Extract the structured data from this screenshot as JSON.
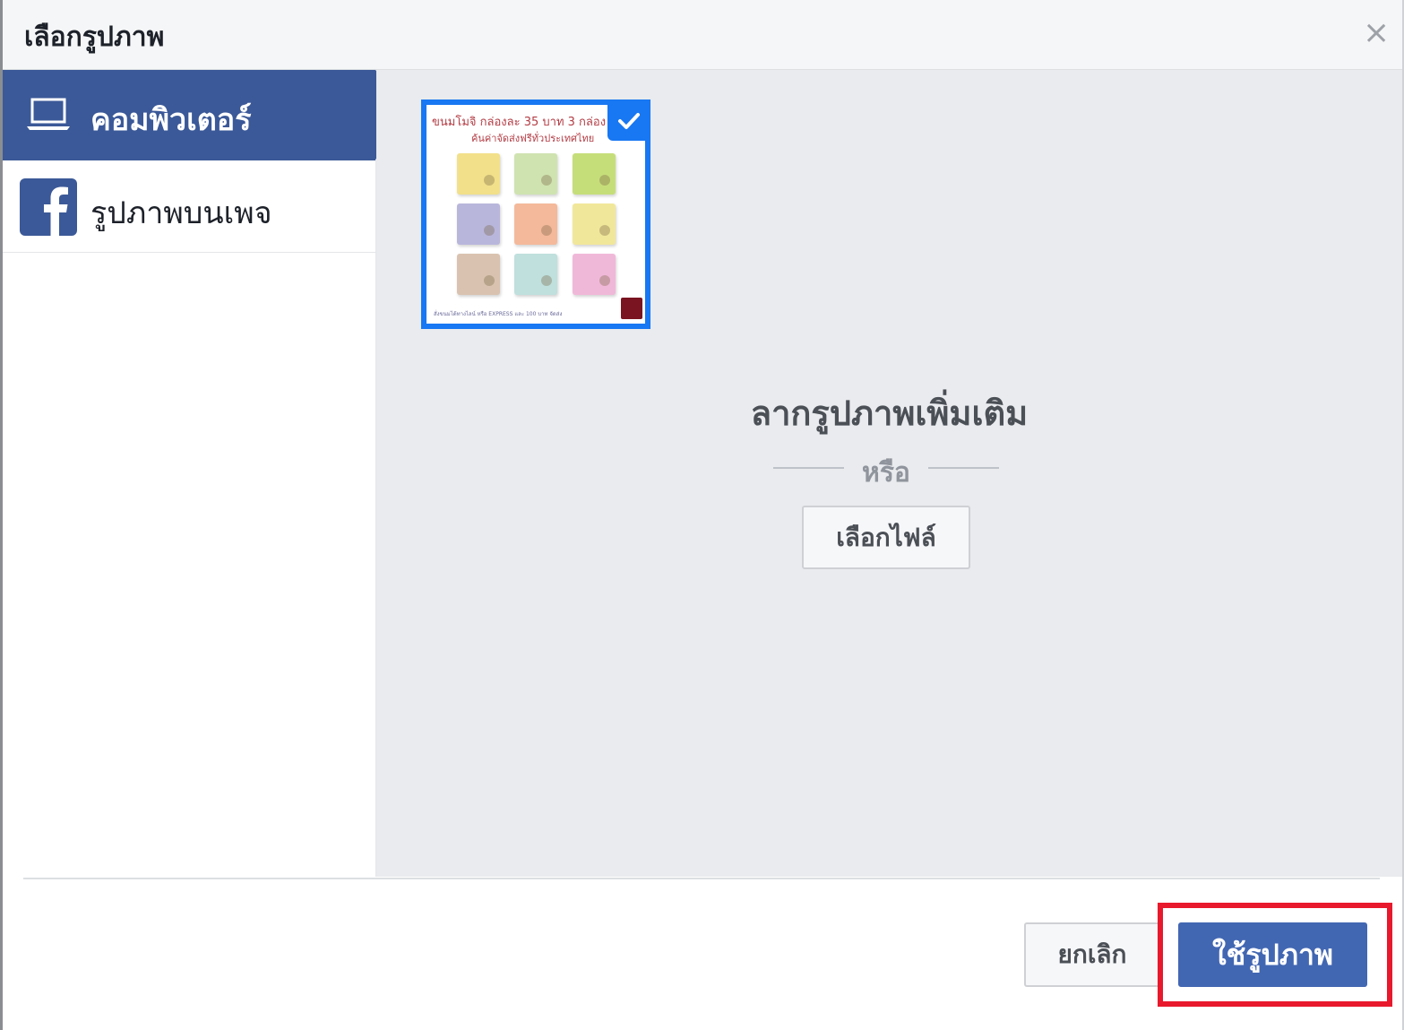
{
  "dialog": {
    "title": "เลือกรูปภาพ",
    "close_icon": "close-icon"
  },
  "sidebar": {
    "items": [
      {
        "label": "คอมพิวเตอร์",
        "icon": "laptop-icon",
        "active": true
      },
      {
        "label": "รูปภาพบนเพจ",
        "icon": "facebook-icon",
        "active": false
      }
    ]
  },
  "main": {
    "thumbnail": {
      "caption_line1": "ขนมโมจิ กล่องละ 35 บาท 3 กล่อง 10",
      "caption_line2": "ค้นค่าจัดส่งฟรีทั่วประเทศไทย",
      "footer_text": "สั่งขนมได้ทางไลน์ หรือ EXPRESS และ 100 บาท จัดส่ง",
      "selected": true,
      "product_colors": [
        "#f2e08a",
        "#cfe3b0",
        "#c6de7a",
        "#b9b6dc",
        "#f4b99a",
        "#f1e79a",
        "#d9c3b0",
        "#bfe0dd",
        "#f0b8d8"
      ]
    },
    "drag_text": "ลากรูปภาพเพิ่มเติม",
    "or_text": "หรือ",
    "choose_file_label": "เลือกไฟล์"
  },
  "footer": {
    "cancel_label": "ยกเลิก",
    "use_label": "ใช้รูปภาพ"
  },
  "colors": {
    "brand": "#3b5998",
    "primary_button": "#4267b2",
    "selection": "#1877f2",
    "highlight": "#e8192c"
  }
}
